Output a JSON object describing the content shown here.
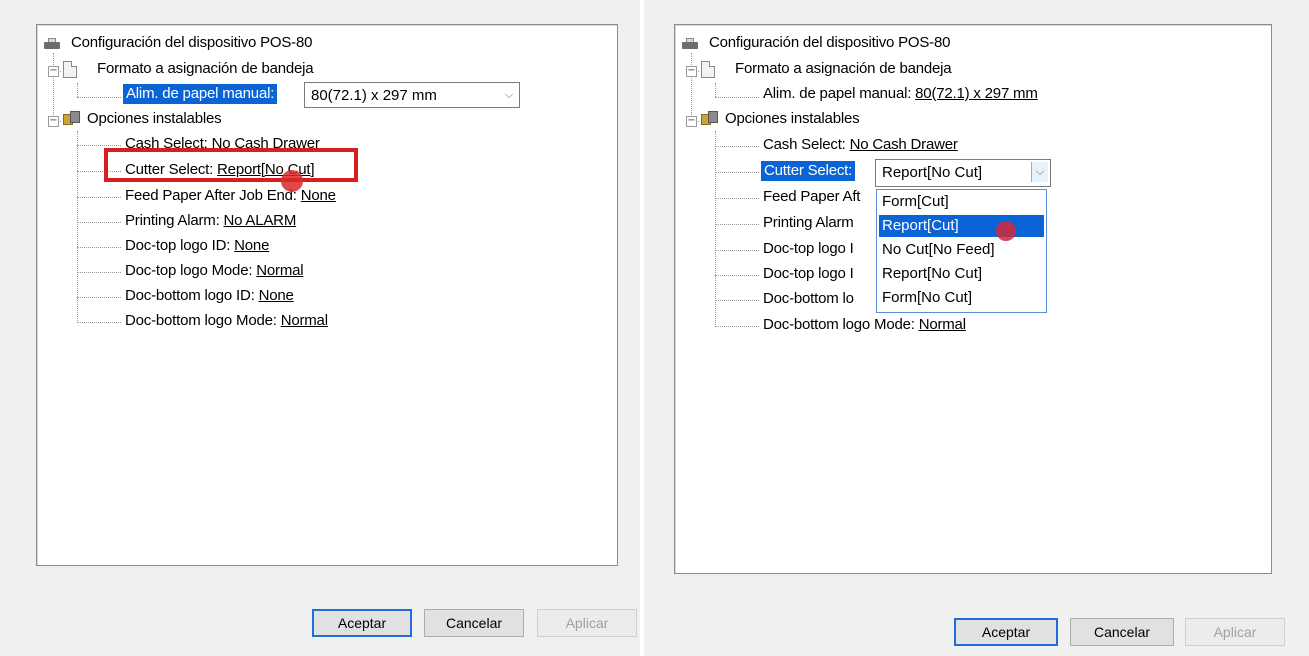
{
  "left": {
    "root_label": "Configuración del dispositivo POS-80",
    "tray_label": "Formato a asignación de bandeja",
    "paper_feed_label": "Alim. de papel manual:",
    "paper_feed_value": "80(72.1) x 297 mm",
    "options_label": "Opciones instalables",
    "options": [
      {
        "label": "Cash Select: ",
        "value": "No Cash Drawer"
      },
      {
        "label": "Cutter Select: ",
        "value": "Report[No Cut]"
      },
      {
        "label": "Feed Paper After Job End: ",
        "value": "None"
      },
      {
        "label": "Printing Alarm: ",
        "value": "No ALARM"
      },
      {
        "label": "Doc-top logo ID: ",
        "value": "None"
      },
      {
        "label": "Doc-top logo Mode: ",
        "value": "Normal"
      },
      {
        "label": "Doc-bottom logo ID: ",
        "value": "None"
      },
      {
        "label": "Doc-bottom logo Mode: ",
        "value": "Normal"
      }
    ],
    "buttons": {
      "ok": "Aceptar",
      "cancel": "Cancelar",
      "apply": "Aplicar"
    }
  },
  "right": {
    "root_label": "Configuración del dispositivo POS-80",
    "tray_label": "Formato a asignación de bandeja",
    "paper_feed_label": "Alim. de papel manual: ",
    "paper_feed_value": "80(72.1) x 297 mm",
    "options_label": "Opciones instalables",
    "cash_label": "Cash Select: ",
    "cash_value": "No Cash Drawer",
    "cutter_label": "Cutter Select:",
    "cutter_value": "Report[No Cut]",
    "partial_rows": [
      "Feed Paper Aft",
      "Printing Alarm",
      "Doc-top logo I",
      "Doc-top logo I",
      "Doc-bottom lo"
    ],
    "bottom_logo_mode_label": "Doc-bottom logo Mode: ",
    "bottom_logo_mode_value": "Normal",
    "dropdown_options": [
      "Form[Cut]",
      "Report[Cut]",
      "No Cut[No Feed]",
      "Report[No Cut]",
      "Form[No Cut]"
    ],
    "dropdown_highlighted": "Report[Cut]",
    "buttons": {
      "ok": "Aceptar",
      "cancel": "Cancelar",
      "apply": "Aplicar"
    }
  },
  "colors": {
    "selection": "#0a64d6",
    "highlight_box": "#d81f1f",
    "default_button_border": "#1e6fd9"
  },
  "icons": [
    "printer-icon",
    "document-icon",
    "options-icon",
    "expand-icon",
    "dropdown-arrow-icon"
  ]
}
